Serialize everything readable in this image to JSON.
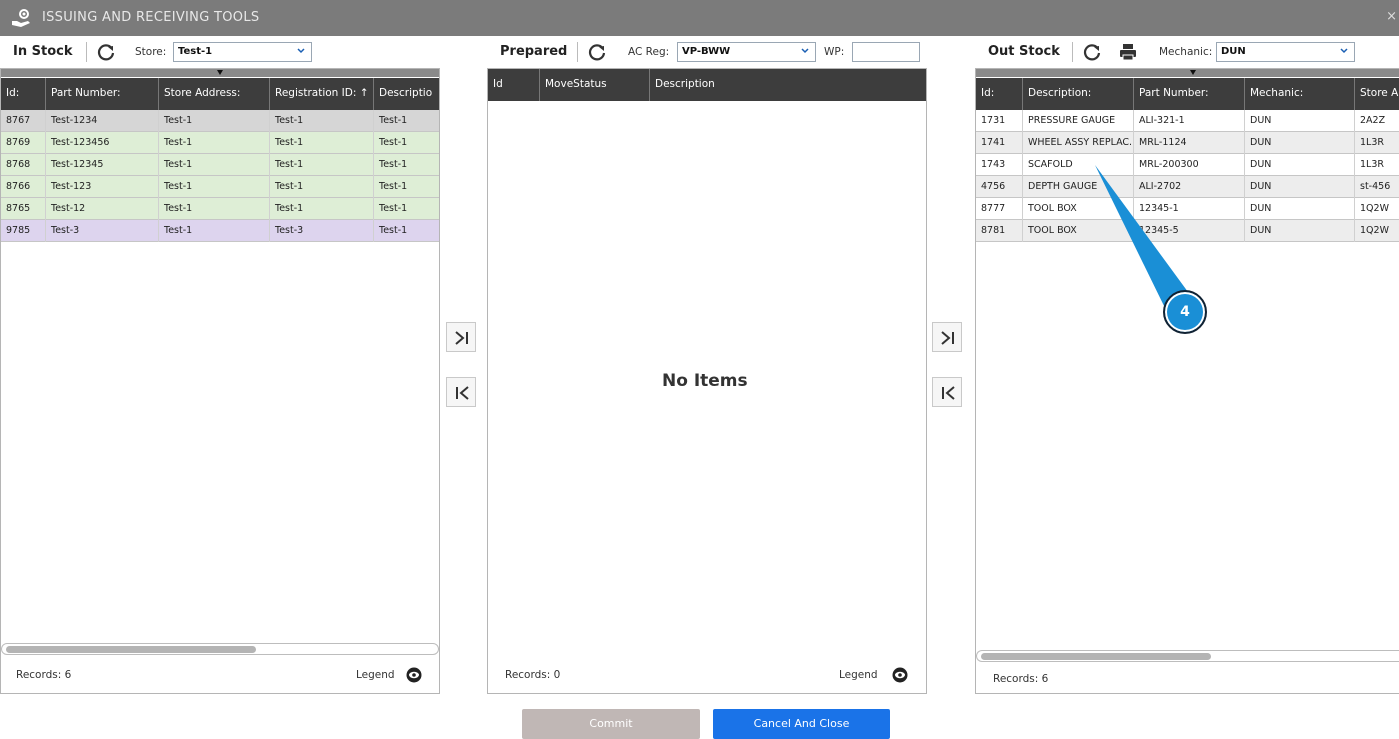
{
  "window": {
    "title": "ISSUING AND RECEIVING TOOLS",
    "close_glyph": "×"
  },
  "in_stock": {
    "label": "In Stock",
    "store_label": "Store:",
    "store_value": "Test-1",
    "columns": [
      "Id:",
      "Part Number:",
      "Store Address:",
      "Registration ID: ↑",
      "Descriptio"
    ],
    "rows": [
      {
        "id": "8767",
        "part_number": "Test-1234",
        "store_address": "Test-1",
        "registration_id": "Test-1",
        "description": "Test-1",
        "color": "gray"
      },
      {
        "id": "8769",
        "part_number": "Test-123456",
        "store_address": "Test-1",
        "registration_id": "Test-1",
        "description": "Test-1",
        "color": "green"
      },
      {
        "id": "8768",
        "part_number": "Test-12345",
        "store_address": "Test-1",
        "registration_id": "Test-1",
        "description": "Test-1",
        "color": "green"
      },
      {
        "id": "8766",
        "part_number": "Test-123",
        "store_address": "Test-1",
        "registration_id": "Test-1",
        "description": "Test-1",
        "color": "green"
      },
      {
        "id": "8765",
        "part_number": "Test-12",
        "store_address": "Test-1",
        "registration_id": "Test-1",
        "description": "Test-1",
        "color": "green"
      },
      {
        "id": "9785",
        "part_number": "Test-3",
        "store_address": "Test-1",
        "registration_id": "Test-3",
        "description": "Test-1",
        "color": "purple"
      }
    ],
    "records": "Records: 6",
    "legend": "Legend"
  },
  "prepared": {
    "label": "Prepared",
    "ac_reg_label": "AC Reg:",
    "ac_reg_value": "VP-BWW",
    "wp_label": "WP:",
    "wp_value": "",
    "columns": [
      "Id",
      "MoveStatus",
      "Description"
    ],
    "empty_text": "No Items",
    "records": "Records: 0",
    "legend": "Legend"
  },
  "out_stock": {
    "label": "Out Stock",
    "mechanic_label": "Mechanic:",
    "mechanic_value": "DUN",
    "columns": [
      "Id:",
      "Description:",
      "Part Number:",
      "Mechanic:",
      "Store A"
    ],
    "rows": [
      {
        "id": "1731",
        "description": "PRESSURE GAUGE",
        "part_number": "ALI-321-1",
        "mechanic": "DUN",
        "store": "2A2Z",
        "color": "white"
      },
      {
        "id": "1741",
        "description": "WHEEL ASSY REPLAC...",
        "part_number": "MRL-1124",
        "mechanic": "DUN",
        "store": "1L3R",
        "color": "light"
      },
      {
        "id": "1743",
        "description": "SCAFOLD",
        "part_number": "MRL-200300",
        "mechanic": "DUN",
        "store": "1L3R",
        "color": "white"
      },
      {
        "id": "4756",
        "description": "DEPTH GAUGE",
        "part_number": "ALI-2702",
        "mechanic": "DUN",
        "store": "st-456",
        "color": "light"
      },
      {
        "id": "8777",
        "description": "TOOL BOX",
        "part_number": "12345-1",
        "mechanic": "DUN",
        "store": "1Q2W",
        "color": "white"
      },
      {
        "id": "8781",
        "description": "TOOL BOX",
        "part_number": "12345-5",
        "mechanic": "DUN",
        "store": "1Q2W",
        "color": "light"
      }
    ],
    "records": "Records: 6"
  },
  "buttons": {
    "commit": "Commit",
    "cancel_close": "Cancel And Close"
  },
  "callout": {
    "number": "4"
  },
  "colors": {
    "accent": "#1a73e8",
    "header": "#3d3d3d",
    "titlebar": "#7b7b7b",
    "callout": "#1a8fd6"
  }
}
